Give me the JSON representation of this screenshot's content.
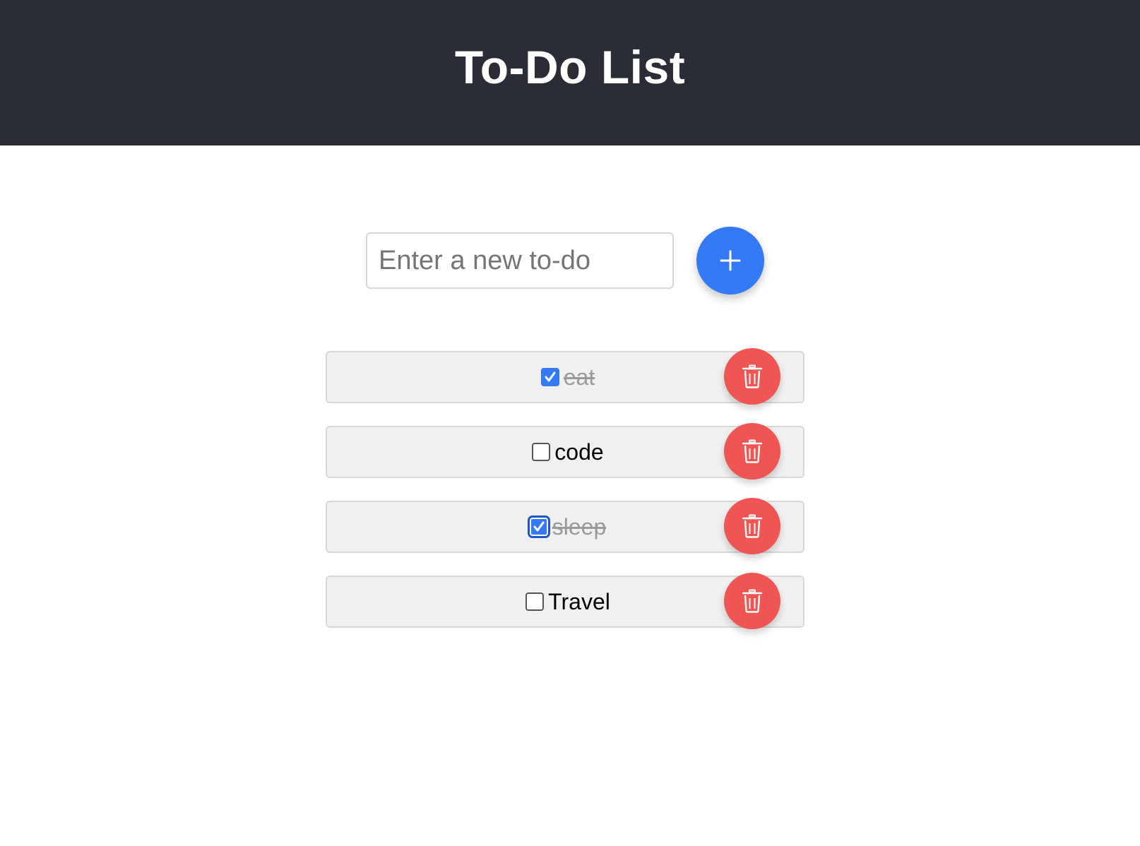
{
  "header": {
    "title": "To-Do List"
  },
  "input": {
    "placeholder": "Enter a new to-do",
    "value": ""
  },
  "add_button": {
    "icon": "plus-icon"
  },
  "todos": [
    {
      "label": "eat",
      "done": true
    },
    {
      "label": "code",
      "done": false
    },
    {
      "label": "sleep",
      "done": true
    },
    {
      "label": "Travel",
      "done": false
    }
  ],
  "colors": {
    "header_bg": "#2a2d35",
    "accent": "#3479f5",
    "delete": "#ef5552"
  }
}
